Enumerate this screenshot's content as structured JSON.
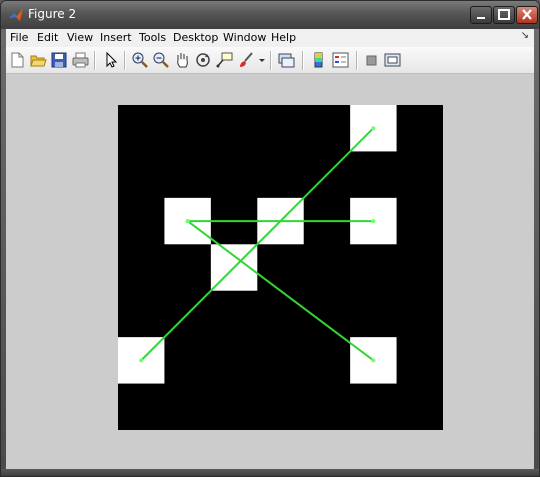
{
  "window": {
    "title": "Figure 2"
  },
  "menu": {
    "items": [
      "File",
      "Edit",
      "View",
      "Insert",
      "Tools",
      "Desktop",
      "Window",
      "Help"
    ],
    "overflow_icon": "dock-arrow-icon"
  },
  "toolbar": {
    "buttons": [
      "new-figure-icon",
      "open-file-icon",
      "save-icon",
      "print-icon",
      "pointer-icon",
      "zoom-in-icon",
      "zoom-out-icon",
      "pan-hand-icon",
      "rotate-3d-icon",
      "data-cursor-icon",
      "brush-icon",
      "dropdown-arrow-icon",
      "link-plot-icon",
      "colorbar-icon",
      "legend-icon",
      "hide-tools-icon",
      "show-tools-icon"
    ]
  },
  "image": {
    "grid_size": 7,
    "background": "#000000",
    "foreground": "#ffffff",
    "white_cells": [
      [
        0,
        5
      ],
      [
        2,
        1
      ],
      [
        2,
        3
      ],
      [
        2,
        5
      ],
      [
        3,
        2
      ],
      [
        5,
        0
      ],
      [
        5,
        5
      ]
    ],
    "lines": [
      {
        "from": [
          0,
          5
        ],
        "to": [
          5,
          0
        ]
      },
      {
        "from": [
          2,
          1
        ],
        "to": [
          2,
          5
        ]
      },
      {
        "from": [
          2,
          1
        ],
        "to": [
          5,
          5
        ]
      }
    ],
    "line_color": "#33d633",
    "marker_color": "#6fff6f"
  }
}
